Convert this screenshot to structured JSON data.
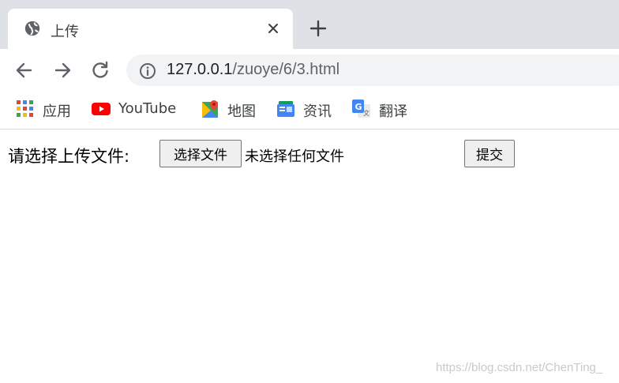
{
  "tab": {
    "title": "上传",
    "favicon": "globe-icon"
  },
  "toolbar": {
    "url_host": "127.0.0.1",
    "url_path": "/zuoye/6/3.html"
  },
  "bookmarks": [
    {
      "label": "应用",
      "icon": "apps-grid-icon"
    },
    {
      "label": "YouTube",
      "icon": "youtube-icon"
    },
    {
      "label": "地图",
      "icon": "maps-icon"
    },
    {
      "label": "资讯",
      "icon": "news-icon"
    },
    {
      "label": "翻译",
      "icon": "translate-icon"
    }
  ],
  "form": {
    "label": "请选择上传文件:",
    "choose_button": "选择文件",
    "no_file_text": "未选择任何文件",
    "submit_button": "提交"
  },
  "watermark": "https://blog.csdn.net/ChenTing_",
  "colors": {
    "tabstrip": "#dee1e6",
    "omnibox": "#f1f3f4",
    "youtube_red": "#ff0000"
  }
}
